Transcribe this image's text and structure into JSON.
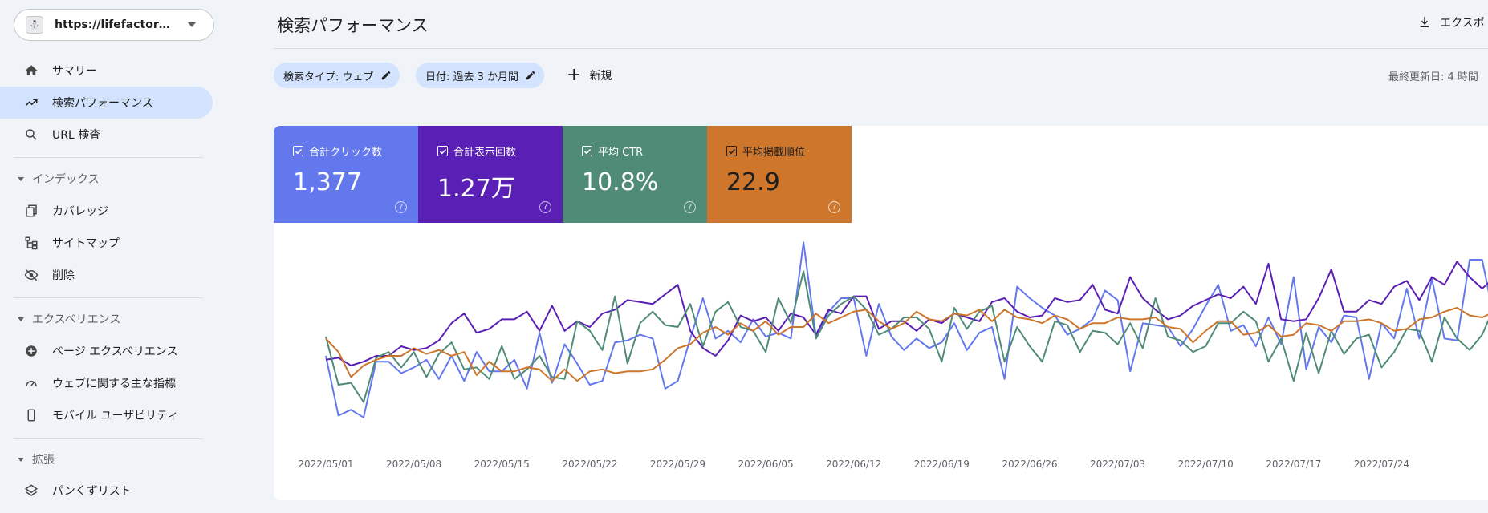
{
  "property": {
    "url": "https://lifefactorybl...",
    "favicon_text": "⛄"
  },
  "nav": {
    "summary": "サマリー",
    "performance": "検索パフォーマンス",
    "url_inspection": "URL 検査",
    "index_section": "インデックス",
    "coverage": "カバレッジ",
    "sitemaps": "サイトマップ",
    "removals": "削除",
    "experience_section": "エクスペリエンス",
    "page_experience": "ページ エクスペリエンス",
    "core_web_vitals": "ウェブに関する主な指標",
    "mobile_usability": "モバイル ユーザビリティ",
    "enhancements_section": "拡張",
    "breadcrumbs": "パンくずリスト"
  },
  "header": {
    "title": "検索パフォーマンス",
    "export": "エクスポ",
    "filter_type": "検索タイプ: ウェブ",
    "filter_date": "日付: 過去 3 か月間",
    "new": "新規",
    "last_updated": "最終更新日: 4 時間"
  },
  "metrics": [
    {
      "label": "合計クリック数",
      "value": "1,377",
      "color": "#6478ee"
    },
    {
      "label": "合計表示回数",
      "value": "1.27万",
      "color": "#5a1fb4"
    },
    {
      "label": "平均 CTR",
      "value": "10.8%",
      "color": "#4f8b77"
    },
    {
      "label": "平均掲載順位",
      "value": "22.9",
      "color": "#cd762c"
    }
  ],
  "chart_data": {
    "type": "line",
    "x_ticks": [
      "2022/05/01",
      "2022/05/08",
      "2022/05/15",
      "2022/05/22",
      "2022/05/29",
      "2022/06/05",
      "2022/06/12",
      "2022/06/19",
      "2022/06/26",
      "2022/07/03",
      "2022/07/10",
      "2022/07/17",
      "2022/07/24"
    ],
    "x_start": "2022/05/01",
    "days": 94,
    "ylim": [
      0,
      100
    ],
    "series": [
      {
        "metric": "合計クリック数",
        "color": "#6478ee",
        "values": [
          35,
          4,
          7,
          3,
          32,
          32,
          26,
          29,
          33,
          23,
          35,
          22,
          37,
          27,
          27,
          33,
          18,
          47,
          21,
          41,
          31,
          20,
          22,
          42,
          43,
          46,
          44,
          18,
          22,
          44,
          65,
          44,
          48,
          42,
          54,
          45,
          47,
          44,
          94,
          45,
          58,
          65,
          65,
          35,
          62,
          45,
          38,
          44,
          39,
          42,
          52,
          38,
          47,
          50,
          23,
          71,
          65,
          60,
          56,
          46,
          49,
          54,
          69,
          64,
          27,
          52,
          51,
          50,
          40,
          49,
          61,
          72,
          48,
          51,
          40,
          55,
          41,
          76,
          28,
          50,
          42,
          56,
          55,
          23,
          52,
          44,
          70,
          44,
          75,
          44,
          43,
          85,
          85,
          53,
          52,
          56
        ]
      },
      {
        "metric": "合計表示回数",
        "color": "#5a1fb4",
        "values": [
          33,
          34,
          30,
          32,
          35,
          35,
          40,
          38,
          39,
          43,
          52,
          57,
          47,
          49,
          54,
          54,
          58,
          48,
          61,
          48,
          53,
          50,
          57,
          59,
          64,
          63,
          62,
          67,
          72,
          48,
          39,
          35,
          43,
          56,
          53,
          55,
          48,
          57,
          55,
          46,
          59,
          57,
          66,
          66,
          49,
          53,
          53,
          48,
          54,
          52,
          57,
          55,
          53,
          63,
          65,
          58,
          55,
          56,
          65,
          63,
          64,
          72,
          59,
          57,
          76,
          65,
          59,
          54,
          56,
          61,
          64,
          67,
          65,
          71,
          62,
          83,
          54,
          53,
          54,
          65,
          80,
          58,
          58,
          64,
          62,
          71,
          74,
          64,
          76,
          72,
          84,
          76,
          70,
          76,
          84,
          88,
          86,
          87,
          91
        ]
      },
      {
        "metric": "平均 CTR",
        "color": "#4f8b77",
        "values": [
          45,
          20,
          21,
          11,
          34,
          37,
          29,
          37,
          24,
          36,
          42,
          28,
          29,
          23,
          40,
          23,
          28,
          35,
          24,
          23,
          53,
          48,
          38,
          66,
          31,
          52,
          58,
          51,
          50,
          62,
          40,
          58,
          63,
          50,
          48,
          37,
          65,
          52,
          79,
          44,
          56,
          62,
          66,
          59,
          46,
          49,
          55,
          55,
          49,
          32,
          60,
          49,
          58,
          61,
          32,
          50,
          40,
          32,
          53,
          51,
          37,
          48,
          47,
          41,
          52,
          39,
          65,
          45,
          43,
          37,
          40,
          52,
          52,
          58,
          53,
          32,
          44,
          22,
          47,
          26,
          48,
          36,
          44,
          46,
          29,
          37,
          49,
          48,
          32,
          55,
          44,
          38,
          46,
          61,
          42,
          38,
          42,
          31,
          46,
          48,
          45,
          49,
          42,
          32,
          32
        ]
      },
      {
        "metric": "平均掲載順位",
        "color": "#cd762c",
        "values": [
          44,
          37,
          24,
          30,
          33,
          35,
          35,
          39,
          36,
          38,
          35,
          37,
          25,
          32,
          27,
          27,
          29,
          28,
          22,
          28,
          22,
          27,
          28,
          26,
          27,
          27,
          28,
          33,
          39,
          41,
          47,
          50,
          46,
          52,
          48,
          53,
          46,
          50,
          50,
          57,
          52,
          55,
          58,
          59,
          53,
          49,
          52,
          58,
          54,
          53,
          57,
          56,
          59,
          53,
          59,
          55,
          54,
          52,
          56,
          54,
          49,
          52,
          52,
          55,
          54,
          54,
          55,
          50,
          49,
          42,
          48,
          53,
          53,
          46,
          47,
          51,
          45,
          46,
          52,
          51,
          48,
          53,
          53,
          54,
          52,
          48,
          49,
          54,
          55,
          58,
          60,
          56,
          55,
          58,
          55,
          51,
          48,
          48,
          55
        ]
      }
    ]
  }
}
